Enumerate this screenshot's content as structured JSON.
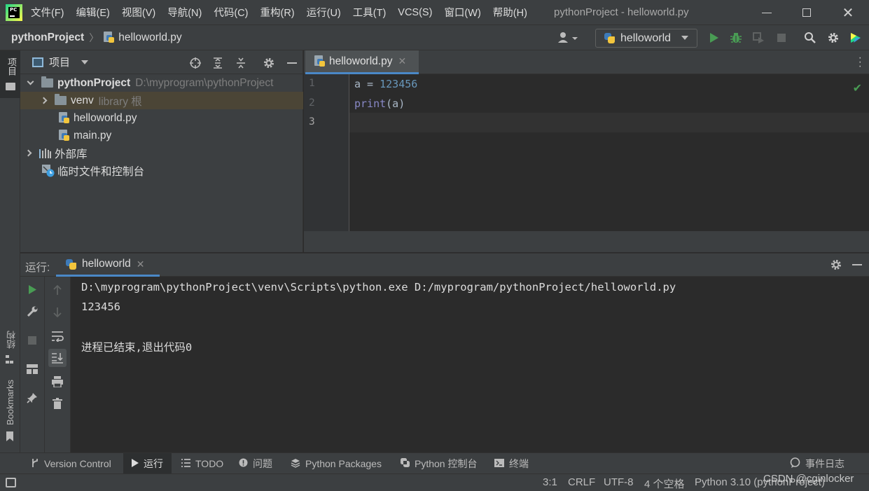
{
  "menu": {
    "items": [
      "文件(F)",
      "编辑(E)",
      "视图(V)",
      "导航(N)",
      "代码(C)",
      "重构(R)",
      "运行(U)",
      "工具(T)",
      "VCS(S)",
      "窗口(W)",
      "帮助(H)"
    ],
    "window_title": "pythonProject - helloworld.py"
  },
  "nav": {
    "project": "pythonProject",
    "file": "helloworld.py",
    "run_config": "helloworld"
  },
  "left_strip": {
    "project": "项目",
    "structure": "结构",
    "bookmarks": "Bookmarks"
  },
  "project_panel": {
    "title": "项目",
    "tree": [
      {
        "label": "pythonProject",
        "hint": "D:\\myprogram\\pythonProject"
      },
      {
        "label": "venv",
        "hint": "library 根"
      },
      {
        "label": "helloworld.py",
        "hint": ""
      },
      {
        "label": "main.py",
        "hint": ""
      },
      {
        "label": "外部库",
        "hint": ""
      },
      {
        "label": "临时文件和控制台",
        "hint": ""
      }
    ]
  },
  "editor": {
    "tab": "helloworld.py",
    "line_numbers": [
      "1",
      "2",
      "3"
    ],
    "lines": [
      {
        "var": "a",
        "op": " = ",
        "value": "123456"
      },
      {
        "fn": "print",
        "args": "(a)"
      },
      {}
    ]
  },
  "run_panel": {
    "label": "运行:",
    "tab": "helloworld",
    "console": [
      "D:\\myprogram\\pythonProject\\venv\\Scripts\\python.exe D:/myprogram/pythonProject/helloworld.py",
      "123456",
      "",
      "进程已结束,退出代码0"
    ]
  },
  "bottom_tabs": {
    "version_control": "Version Control",
    "run": "运行",
    "todo": "TODO",
    "problems": "问题",
    "python_packages": "Python Packages",
    "python_console": "Python 控制台",
    "terminal": "终端",
    "event_log": "事件日志"
  },
  "status": {
    "position": "3:1",
    "line_sep": "CRLF",
    "encoding": "UTF-8",
    "indent": "4 个空格",
    "interpreter": "Python 3.10 (pythonProject)"
  },
  "watermark": "CSDN @cginlocker"
}
